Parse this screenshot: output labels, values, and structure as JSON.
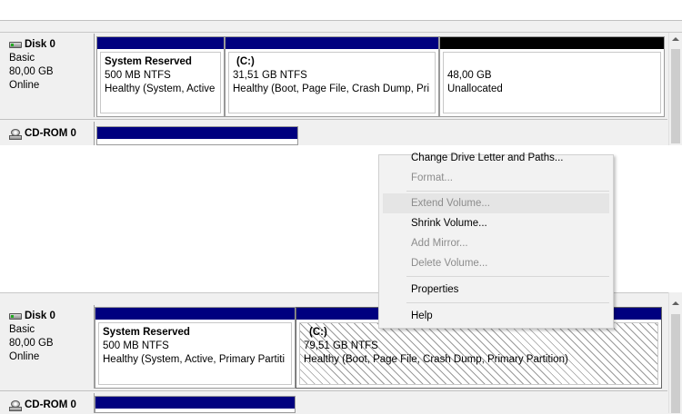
{
  "top": {
    "disk0": {
      "name": "Disk 0",
      "type": "Basic",
      "size": "80,00 GB",
      "status": "Online",
      "partitions": [
        {
          "name": "System Reserved",
          "size": "500 MB NTFS",
          "status": "Healthy (System, Active"
        },
        {
          "name": "(C:)",
          "size": "31,51 GB NTFS",
          "status": "Healthy (Boot, Page File, Crash Dump, Pri"
        },
        {
          "size": "48,00 GB",
          "status": "Unallocated"
        }
      ]
    },
    "cdrom": {
      "name": "CD-ROM 0"
    }
  },
  "context_menu": {
    "items": [
      {
        "label": "Change Drive Letter and Paths...",
        "enabled": true
      },
      {
        "label": "Format...",
        "enabled": false
      },
      {
        "label": "Extend Volume...",
        "enabled": false,
        "highlighted": true
      },
      {
        "label": "Shrink Volume...",
        "enabled": true
      },
      {
        "label": "Add Mirror...",
        "enabled": false
      },
      {
        "label": "Delete Volume...",
        "enabled": false
      },
      {
        "label": "Properties",
        "enabled": true
      },
      {
        "label": "Help",
        "enabled": true
      }
    ]
  },
  "bottom": {
    "disk0": {
      "name": "Disk 0",
      "type": "Basic",
      "size": "80,00 GB",
      "status": "Online",
      "partitions": [
        {
          "name": "System Reserved",
          "size": "500 MB NTFS",
          "status": "Healthy (System, Active, Primary Partiti"
        },
        {
          "name": "(C:)",
          "size": "79,51 GB NTFS",
          "status": "Healthy (Boot, Page File, Crash Dump, Primary Partition)"
        }
      ]
    },
    "cdrom": {
      "name": "CD-ROM 0"
    }
  },
  "colors": {
    "primary_partition": "#00007f",
    "unallocated": "#000000",
    "panel_bg": "#f0f0f0"
  }
}
